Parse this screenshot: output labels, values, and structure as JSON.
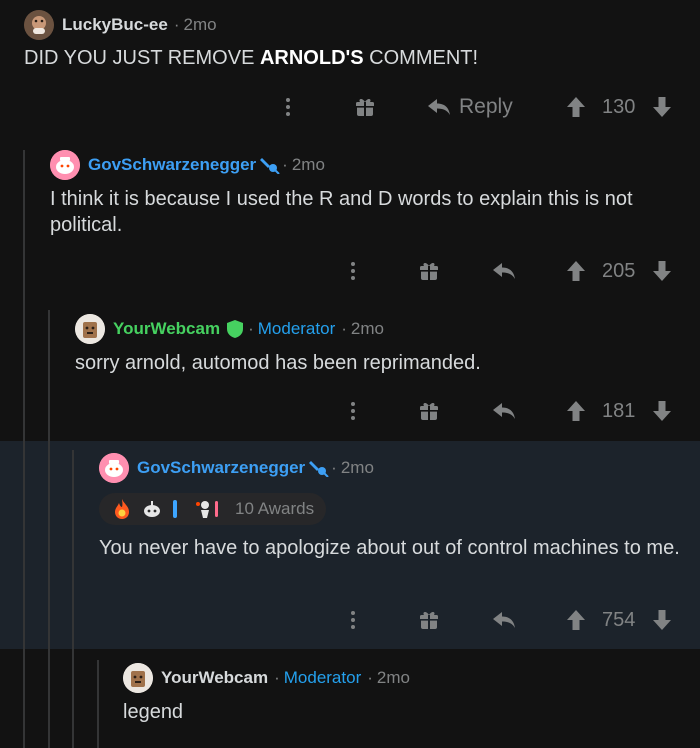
{
  "comments": [
    {
      "username": "LuckyBuc-ee",
      "username_color": "#d7dadc",
      "age": "2mo",
      "body_prefix": "DID YOU JUST REMOVE ",
      "body_bold": "ARNOLD'S",
      "body_suffix": " COMMENT!",
      "reply_label": "Reply",
      "score": "130"
    },
    {
      "username": "GovSchwarzenegger",
      "username_color": "#3d9ff4",
      "age": "2mo",
      "body": "I think it is because I used the R and D words to explain this is not political.",
      "score": "205"
    },
    {
      "username": "YourWebcam",
      "username_color": "#46d160",
      "role": "Moderator",
      "age": "2mo",
      "body": "sorry arnold, automod has been reprimanded.",
      "score": "181"
    },
    {
      "username": "GovSchwarzenegger",
      "username_color": "#3d9ff4",
      "age": "2mo",
      "awards_label": "10 Awards",
      "body": "You never have to apologize about out of control machines to me.",
      "score": "754"
    },
    {
      "username": "YourWebcam",
      "username_color": "#d7dadc",
      "role": "Moderator",
      "age": "2mo",
      "body": "legend"
    }
  ],
  "separator": "·",
  "colors": {
    "background": "#121212",
    "highlight": "#1c232b",
    "meta": "#818384",
    "moderator": "#24a0ed",
    "thread_line": "#343536"
  }
}
